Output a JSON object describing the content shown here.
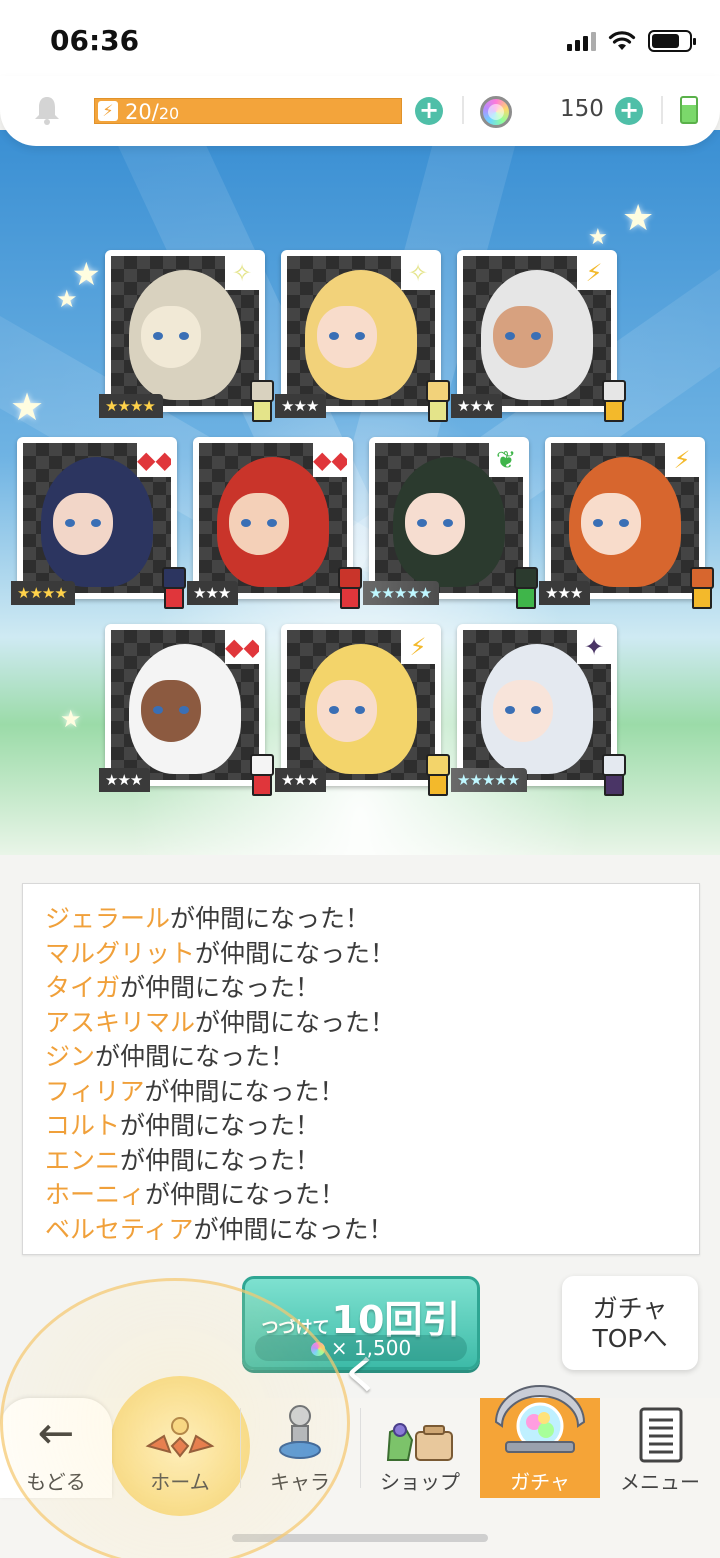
{
  "status_bar": {
    "time": "06:36"
  },
  "resources": {
    "stamina_current": "20",
    "stamina_sep": "/",
    "stamina_max": "20",
    "stamina_bolt": "⚡",
    "gems": "150",
    "plus_symbol": "+"
  },
  "cards": [
    {
      "attr": "✧",
      "attr_color": "#e4e48a",
      "rarity": "★★★★",
      "rarity_type": "gold",
      "hair": "#d9d2bf",
      "skin": "#f1e9d6"
    },
    {
      "attr": "✧",
      "attr_color": "#e4e48a",
      "rarity": "★★★",
      "rarity_type": "silver",
      "hair": "#f2d27a",
      "skin": "#f8dccb"
    },
    {
      "attr": "⚡",
      "attr_color": "#f3b92b",
      "rarity": "★★★",
      "rarity_type": "silver",
      "hair": "#e6e6e6",
      "skin": "#d7a17f"
    },
    {
      "attr": "◆◆",
      "attr_color": "#e0363b",
      "rarity": "★★★★",
      "rarity_type": "gold",
      "hair": "#2c3560",
      "skin": "#f2d6c8"
    },
    {
      "attr": "◆◆",
      "attr_color": "#e0363b",
      "rarity": "★★★",
      "rarity_type": "silver",
      "hair": "#c9342a",
      "skin": "#f4d0b8"
    },
    {
      "attr": "❦",
      "attr_color": "#3fb54a",
      "rarity": "★★★★★",
      "rarity_type": "rainbow",
      "hair": "#2b3a2e",
      "skin": "#f6ddd0"
    },
    {
      "attr": "⚡",
      "attr_color": "#f3b92b",
      "rarity": "★★★",
      "rarity_type": "silver",
      "hair": "#d7662e",
      "skin": "#f8dccb"
    },
    {
      "attr": "◆◆",
      "attr_color": "#e0363b",
      "rarity": "★★★",
      "rarity_type": "silver",
      "hair": "#f4f4f4",
      "skin": "#8c5a40"
    },
    {
      "attr": "⚡",
      "attr_color": "#f3b92b",
      "rarity": "★★★",
      "rarity_type": "silver",
      "hair": "#f3d46a",
      "skin": "#f8dccb"
    },
    {
      "attr": "✦",
      "attr_color": "#4a3566",
      "rarity": "★★★★★",
      "rarity_type": "rainbow",
      "hair": "#e4e9f0",
      "skin": "#f8e4da"
    }
  ],
  "results": [
    {
      "name": "ジェラール",
      "suffix": "が仲間になった！"
    },
    {
      "name": "マルグリット",
      "suffix": "が仲間になった！"
    },
    {
      "name": "タイガ",
      "suffix": "が仲間になった！"
    },
    {
      "name": "アスキリマル",
      "suffix": "が仲間になった！"
    },
    {
      "name": "ジン",
      "suffix": "が仲間になった！"
    },
    {
      "name": "フィリア",
      "suffix": "が仲間になった！"
    },
    {
      "name": "コルト",
      "suffix": "が仲間になった！"
    },
    {
      "name": "エンニ",
      "suffix": "が仲間になった！"
    },
    {
      "name": "ホーニィ",
      "suffix": "が仲間になった！"
    },
    {
      "name": "ベルセティア",
      "suffix": "が仲間になった！"
    }
  ],
  "draw_button": {
    "prefix": "つづけて",
    "label": "10回引く",
    "cost": "× 1,500"
  },
  "gacha_top_button": {
    "line1": "ガチャ",
    "line2": "TOPへ"
  },
  "nav": {
    "back": {
      "icon": "←",
      "label": "もどる"
    },
    "home": {
      "label": "ホーム"
    },
    "chara": {
      "label": "キャラ"
    },
    "shop": {
      "label": "ショップ"
    },
    "gacha": {
      "label": "ガチャ"
    },
    "menu": {
      "label": "メニュー"
    }
  }
}
